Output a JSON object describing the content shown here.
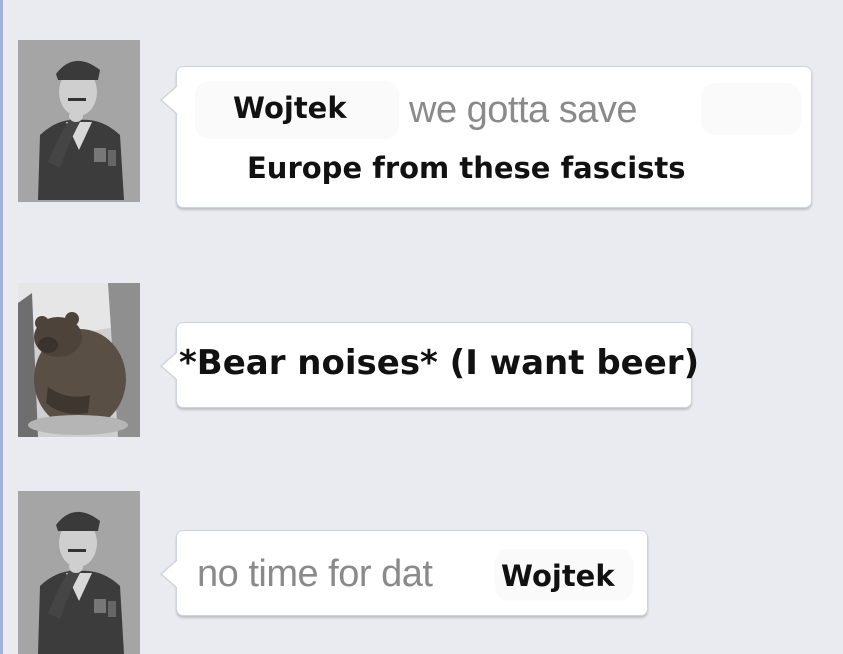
{
  "messages": [
    {
      "avatar_icon": "soldier-portrait-icon",
      "name_label": "Wojtek",
      "text_line1": "we gotta save",
      "text_line2": "Europe from these fascists"
    },
    {
      "avatar_icon": "bear-photo-icon",
      "text": "*Bear noises* (I want beer)"
    },
    {
      "avatar_icon": "soldier-portrait-icon",
      "text": "no time for dat",
      "name_label": "Wojtek"
    }
  ],
  "colors": {
    "background": "#e9ebf1",
    "bubble": "#ffffff",
    "bubble_border": "#cfd3da",
    "grey_text": "#8a8a8a",
    "bold_text": "#111111"
  }
}
